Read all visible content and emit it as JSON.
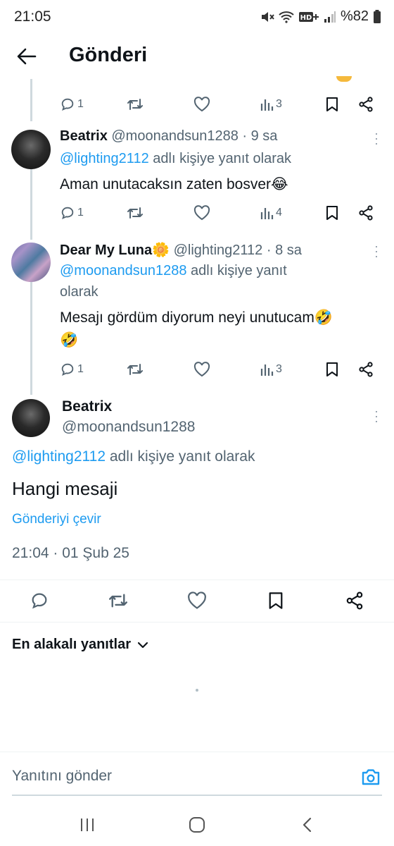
{
  "status_bar": {
    "time": "21:05",
    "battery": "%82",
    "icons": [
      "mute-icon",
      "wifi-icon",
      "hd-plus-icon",
      "signal-icon",
      "battery-icon"
    ]
  },
  "header": {
    "title": "Gönderi",
    "back_icon": "arrow-left-icon"
  },
  "thread": [
    {
      "id": "top-partial",
      "stats": {
        "replies": "1",
        "views": "3"
      }
    },
    {
      "id": "reply-beatrix",
      "name": "Beatrix",
      "meta": "@moonandsun1288 · 9 sa",
      "replying_mention": "@lighting2112",
      "replying_suffix": " adlı kişiye yanıt olarak",
      "text": "Aman unutacaksın zaten bosver😂",
      "stats": {
        "replies": "1",
        "views": "4"
      }
    },
    {
      "id": "reply-luna",
      "name": "Dear My Luna🌼",
      "meta": "@lighting2112 · 8 sa",
      "replying_mention": "@moonandsun1288",
      "replying_suffix": " adlı kişiye yanıt",
      "replying_line2": "olarak",
      "text_line1": "Mesajı gördüm diyorum neyi unutucam🤣",
      "text_line2": "🤣",
      "stats": {
        "replies": "1",
        "views": "3"
      }
    }
  ],
  "main_tweet": {
    "name": "Beatrix",
    "handle": "@moonandsun1288",
    "replying_mention": "@lighting2112",
    "replying_suffix": " adlı kişiye yanıt olarak",
    "text": "Hangi mesaji",
    "translate_label": "Gönderiyi çevir",
    "timestamp": "21:04 · 01 Şub 25"
  },
  "sort": {
    "label": "En alakalı yanıtlar"
  },
  "composer": {
    "placeholder": "Yanıtını gönder"
  },
  "colors": {
    "accent": "#1d9bf0",
    "text_primary": "#0f1419",
    "text_secondary": "#536471",
    "divider": "#eff3f4"
  }
}
